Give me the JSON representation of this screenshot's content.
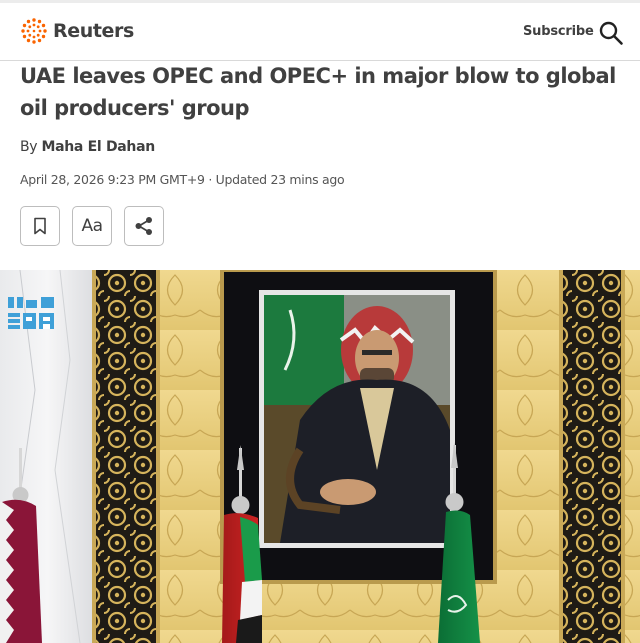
{
  "header": {
    "brand": "Reuters",
    "subscribe_label": "Subscribe",
    "search_icon": "search-icon",
    "brand_color": "#fa6400"
  },
  "article": {
    "headline": "UAE leaves OPEC and OPEC+ in major blow to global oil producers' group",
    "byline_prefix": "By",
    "author": "Maha El Dahan",
    "dateline": "April 28, 2026 9:23 PM GMT+9 · Updated 23 mins ago"
  },
  "toolbar": {
    "bookmark_icon": "bookmark-icon",
    "text_size_label": "Aa",
    "share_icon": "share-icon"
  },
  "hero": {
    "watermark_icon": "spa-watermark"
  }
}
